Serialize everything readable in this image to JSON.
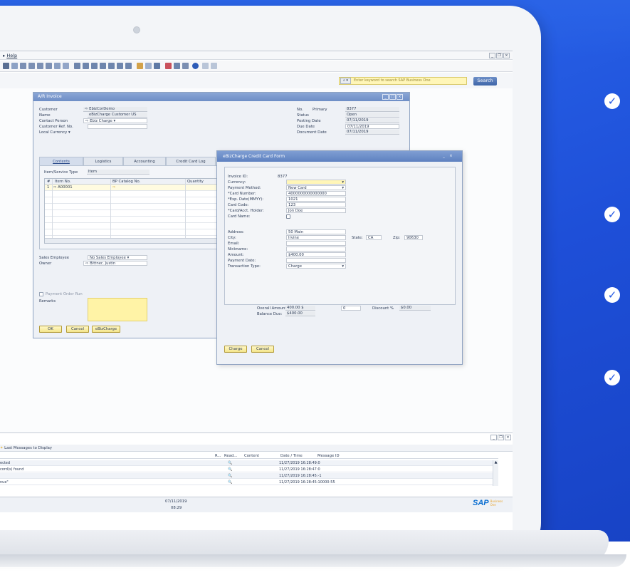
{
  "menu": {
    "help": "Help"
  },
  "search": {
    "placeholder": "Enter keyword to search SAP Business One",
    "button": "Search",
    "dropdown": "⌕ ▾"
  },
  "invoice": {
    "title": "A/R Invoice",
    "fields": {
      "customer_label": "Customer",
      "customer_value": "EbizCorDemo",
      "name_label": "Name",
      "name_value": "eBizCharge Customer US",
      "contact_label": "Contact Person",
      "contact_value": "Ebiz Charge",
      "ref_label": "Customer Ref. No.",
      "currency_label": "Local Currency",
      "no_label": "No.",
      "no_series": "Primary",
      "no_value": "8377",
      "status_label": "Status",
      "status_value": "Open",
      "posting_label": "Posting Date",
      "posting_value": "07/11/2019",
      "due_label": "Due Date",
      "due_value": "07/11/2019",
      "docdate_label": "Document Date",
      "docdate_value": "07/11/2019"
    },
    "tabs": [
      "Contents",
      "Logistics",
      "Accounting",
      "Credit Card Log"
    ],
    "item_type_label": "Item/Service Type",
    "item_type_value": "Item",
    "grid_headers": [
      "#",
      "Item No.",
      "BP Catalog No.",
      "Quantity"
    ],
    "grid_rows": [
      {
        "num": "1",
        "item": "A00001"
      }
    ],
    "sales_employee_label": "Sales Employee",
    "sales_employee_value": "No Sales Employee",
    "owner_label": "Owner",
    "owner_value": "Bittner, Justin",
    "payment_order_label": "Payment Order Run",
    "remarks_label": "Remarks",
    "buttons": {
      "ok": "OK",
      "cancel": "Cancel",
      "ebiz": "eBizCharge"
    }
  },
  "cc_form": {
    "title": "eBizCharge Credit Card Form",
    "invoice_id_label": "Invoice ID:",
    "invoice_id_value": "8377",
    "currency_label": "Currency:",
    "payment_method_label": "Payment Method:",
    "payment_method_value": "New Card",
    "card_number_label": "*Card Number:",
    "card_number_value": "4000000000000000",
    "exp_label": "*Exp. Date(MMYY):",
    "exp_value": "1021",
    "card_code_label": "Card Code:",
    "card_code_value": "123",
    "holder_label": "*Card/Acct. Holder:",
    "holder_value": "Jon Doe",
    "card_name_label": "Card Name:",
    "address_label": "Address:",
    "address_value": "50 Main",
    "city_label": "City:",
    "city_value": "Irvine",
    "state_label": "State:",
    "state_value": "CA",
    "zip_label": "Zip:",
    "zip_value": "90630",
    "email_label": "Email:",
    "nickname_label": "Nickname:",
    "amount_label": "Amount:",
    "amount_value": "$400.00",
    "payment_date_label": "Payment Date:",
    "transaction_type_label": "Transaction Type:",
    "transaction_type_value": "Charge",
    "overall_label": "Overall Amount",
    "overall_value": "400.00 $",
    "discount_field_value": "0",
    "discount_label": "Discount %",
    "discount_value": "$0.00",
    "balance_label": "Balance Due:",
    "balance_value": "$400.00",
    "buttons": {
      "charge": "Charge",
      "cancel": "Cancel"
    }
  },
  "messages": {
    "header": "Last Messages to Display",
    "columns": [
      "R...",
      "Read...",
      "Content",
      "Date / Time",
      "Message ID"
    ],
    "rows": [
      {
        "text": "ected",
        "datetime": "11/27/2019  16:28:49:0"
      },
      {
        "text": "cord(s) found",
        "datetime": "11/27/2019  16:28:47:0"
      },
      {
        "text": "",
        "datetime": "11/27/2019  16:28:45:-1"
      },
      {
        "text": "nue\"",
        "datetime": "11/27/2019  16:28:45:10000-55"
      }
    ]
  },
  "status_bar": {
    "date": "07/11/2019",
    "time": "08:29"
  },
  "sap_logo": {
    "brand": "SAP",
    "product_line1": "Business",
    "product_line2": "One"
  },
  "colors": {
    "background_blue": "#2256e2",
    "sap_blue": "#0a6ed1",
    "check_blue": "#2256e2"
  }
}
